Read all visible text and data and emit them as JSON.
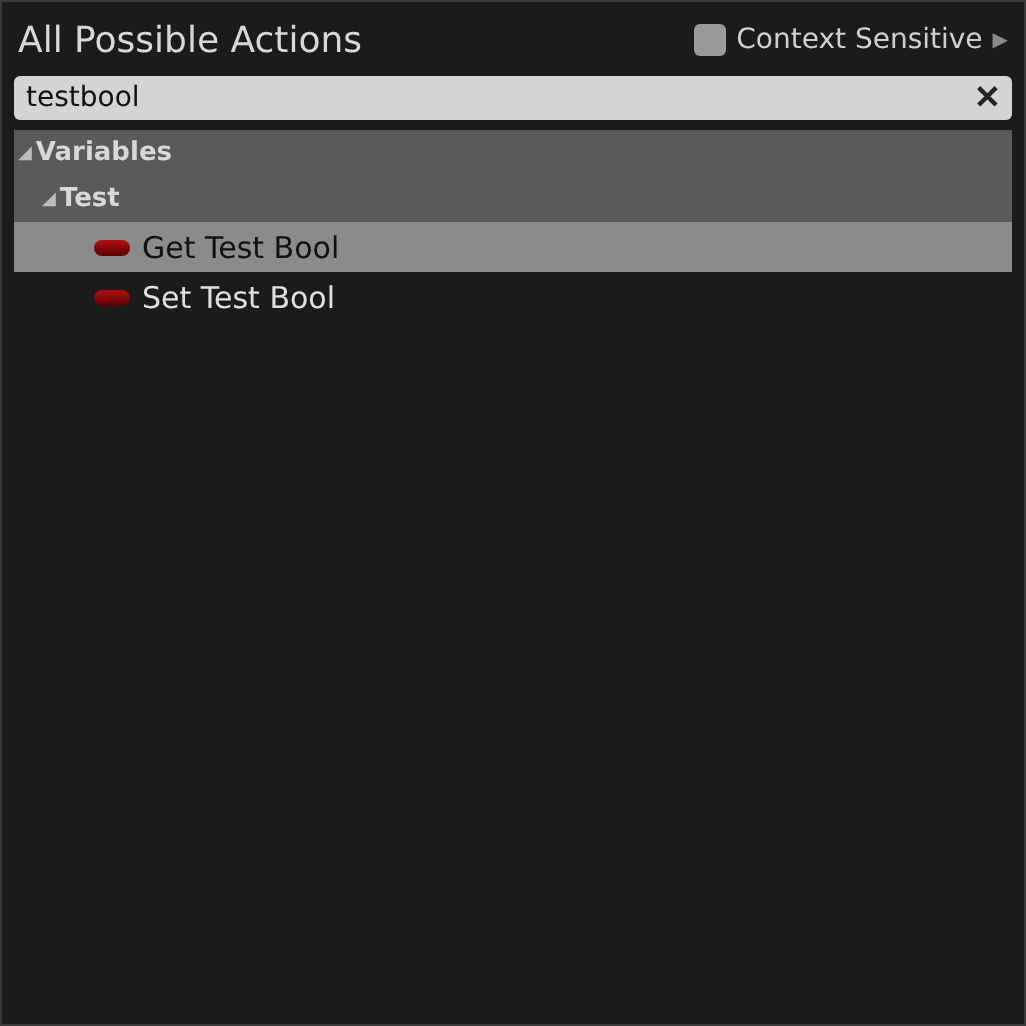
{
  "window": {
    "title": "All Possible Actions"
  },
  "context_sensitive": {
    "label": "Context Sensitive",
    "checked": false,
    "expand_glyph": "▶"
  },
  "search": {
    "value": "testbool",
    "clear_glyph": "✕"
  },
  "tree": [
    {
      "label": "Variables",
      "expanded": true,
      "glyph": "◢",
      "children": [
        {
          "label": "Test",
          "expanded": true,
          "glyph": "◢",
          "children": [
            {
              "label": "Get Test Bool",
              "selected": true
            },
            {
              "label": "Set Test Bool",
              "selected": false
            }
          ]
        }
      ]
    }
  ]
}
